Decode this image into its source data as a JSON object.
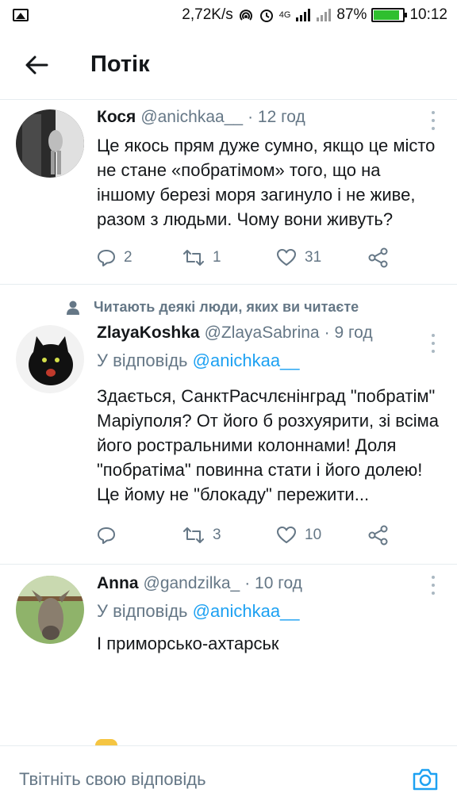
{
  "status_bar": {
    "speed": "2,72K/s",
    "network": "4G",
    "battery": "87%",
    "battery_level": 0.87,
    "time": "10:12"
  },
  "header": {
    "title": "Потік",
    "back_icon": "arrow-left-icon"
  },
  "tweets": [
    {
      "name": "Кося",
      "handle": "@anichkaa__",
      "time": "· 12 год",
      "text": "Це якось прям дуже сумно, якщо це місто не стане «побратімом» того, що на іншому березі моря загинуло і не живе, разом з людьми. Чому вони живуть?",
      "replies": "2",
      "retweets": "1",
      "likes": "31"
    },
    {
      "social_context": "Читають деякі люди, яких ви читаєте",
      "name": "ZlayaKoshka",
      "handle": "@ZlayaSabrina",
      "time": "· 9 год",
      "reply_prefix": "У відповідь",
      "reply_handle": "@anichkaa__",
      "text": "Здається, СанктРасчлєнінград \"побратім\" Маріуполя? От його б розхуярити, зі всіма його ростральними колоннами! Доля \"побратіма\" повинна стати і його долею! Це йому не \"блокаду\" пережити...",
      "replies": "",
      "retweets": "3",
      "likes": "10"
    },
    {
      "name": "Anna",
      "handle": "@gandzilka_",
      "time": "· 10 год",
      "reply_prefix": "У відповідь",
      "reply_handle": "@anichkaa__",
      "text": "І приморсько-ахтарськ"
    }
  ],
  "compose": {
    "placeholder": "Твітніть свою відповідь"
  },
  "colors": {
    "accent": "#1da1f2",
    "secondary_text": "#657786",
    "divider": "#e6ecf0"
  }
}
